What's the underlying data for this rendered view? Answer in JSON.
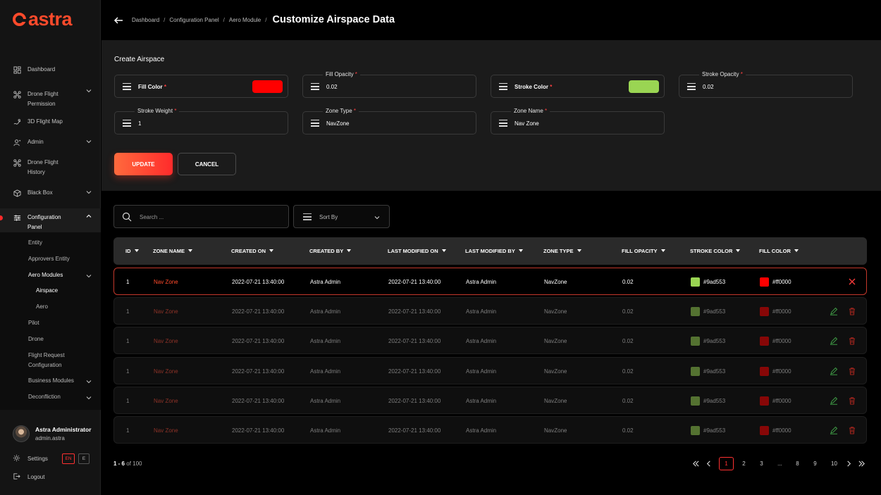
{
  "brand": {
    "name": "astra",
    "color": "#ff4a2b"
  },
  "sidebar": {
    "items": [
      {
        "label": "Dashboard",
        "icon": "dashboard-icon",
        "chevron": false
      },
      {
        "label": "Drone Flight",
        "label2": "Permission",
        "icon": "drone-icon",
        "chevron": true
      },
      {
        "label": "3D Flight Map",
        "icon": "map-icon",
        "chevron": false
      },
      {
        "label": "Admin",
        "icon": "admin-icon",
        "chevron": true
      },
      {
        "label": "Drone Flight",
        "label2": "History",
        "icon": "drone-icon",
        "chevron": false
      },
      {
        "label": "Black Box",
        "icon": "box-icon",
        "chevron": true
      },
      {
        "label": "Configuration",
        "label2": "Panel",
        "icon": "sliders-icon",
        "chevron": true
      }
    ],
    "subitems": [
      {
        "label": "Entity"
      },
      {
        "label": "Approvers Entity"
      },
      {
        "label": "Aero Modules"
      },
      {
        "label": "Airspace"
      },
      {
        "label": "Aero"
      },
      {
        "label": "Pilot"
      },
      {
        "label": "Drone"
      },
      {
        "label": "Flight Request",
        "label2": "Configuration"
      },
      {
        "label": "Business Modules"
      },
      {
        "label": "Deconfliction"
      }
    ],
    "user": {
      "name": "Astra Administrator",
      "email": "admin.astra"
    },
    "settings_label": "Settings",
    "lang_active": "EN",
    "lang_other": "E",
    "logout_label": "Logout"
  },
  "header": {
    "breadcrumbs": [
      "Dashboard",
      "Configuration Panel",
      "Aero Module"
    ],
    "separator": "/",
    "title": "Customize Airspace Data"
  },
  "form": {
    "title": "Create Airspace",
    "fill_color": {
      "label": "Fill Color",
      "value": "#ff0000"
    },
    "fill_opacity": {
      "label": "Fill Opacity",
      "value": "0.02"
    },
    "stroke_color": {
      "label": "Stroke Color",
      "value": "#9ad553"
    },
    "stroke_opacity": {
      "label": "Stroke Opacity",
      "value": "0.02"
    },
    "stroke_weight": {
      "label": "Stroke Weight",
      "value": "1"
    },
    "zone_type": {
      "label": "Zone Type",
      "value": "NavZone"
    },
    "zone_name": {
      "label": "Zone Name",
      "value": "Nav Zone"
    },
    "required_mark": "*",
    "update_label": "UPDATE",
    "cancel_label": "CANCEL"
  },
  "search": {
    "placeholder": "Search ..."
  },
  "sort": {
    "label": "Sort By"
  },
  "table": {
    "columns": [
      "ID",
      "ZONE NAME",
      "CREATED ON",
      "CREATED BY",
      "LAST MODIFIED ON",
      "LAST MODIFIED BY",
      "ZONE TYPE",
      "FILL OPACITY",
      "STROKE COLOR",
      "FILL COLOR"
    ],
    "rows": [
      {
        "id": "1",
        "zone_name": "Nav Zone",
        "created_on": "2022-07-21 13:40:00",
        "created_by": "Astra Admin",
        "modified_on": "2022-07-21 13:40:00",
        "modified_by": "Astra Admin",
        "zone_type": "NavZone",
        "fill_opacity": "0.02",
        "stroke_color": "#9ad553",
        "fill_color": "#ff0000",
        "selected": true
      },
      {
        "id": "1",
        "zone_name": "Nav Zone",
        "created_on": "2022-07-21 13:40:00",
        "created_by": "Astra Admin",
        "modified_on": "2022-07-21 13:40:00",
        "modified_by": "Astra Admin",
        "zone_type": "NavZone",
        "fill_opacity": "0.02",
        "stroke_color": "#9ad553",
        "fill_color": "#ff0000",
        "selected": false
      },
      {
        "id": "1",
        "zone_name": "Nav Zone",
        "created_on": "2022-07-21 13:40:00",
        "created_by": "Astra Admin",
        "modified_on": "2022-07-21 13:40:00",
        "modified_by": "Astra Admin",
        "zone_type": "NavZone",
        "fill_opacity": "0.02",
        "stroke_color": "#9ad553",
        "fill_color": "#ff0000",
        "selected": false
      },
      {
        "id": "1",
        "zone_name": "Nav Zone",
        "created_on": "2022-07-21 13:40:00",
        "created_by": "Astra Admin",
        "modified_on": "2022-07-21 13:40:00",
        "modified_by": "Astra Admin",
        "zone_type": "NavZone",
        "fill_opacity": "0.02",
        "stroke_color": "#9ad553",
        "fill_color": "#ff0000",
        "selected": false
      },
      {
        "id": "1",
        "zone_name": "Nav Zone",
        "created_on": "2022-07-21 13:40:00",
        "created_by": "Astra Admin",
        "modified_on": "2022-07-21 13:40:00",
        "modified_by": "Astra Admin",
        "zone_type": "NavZone",
        "fill_opacity": "0.02",
        "stroke_color": "#9ad553",
        "fill_color": "#ff0000",
        "selected": false
      },
      {
        "id": "1",
        "zone_name": "Nav Zone",
        "created_on": "2022-07-21 13:40:00",
        "created_by": "Astra Admin",
        "modified_on": "2022-07-21 13:40:00",
        "modified_by": "Astra Admin",
        "zone_type": "NavZone",
        "fill_opacity": "0.02",
        "stroke_color": "#9ad553",
        "fill_color": "#ff0000",
        "selected": false
      }
    ]
  },
  "pagination": {
    "range": "1 - 6",
    "of_label": "of",
    "total": "100",
    "pages": [
      "1",
      "2",
      "3",
      "...",
      "8",
      "9",
      "10"
    ],
    "current": "1"
  }
}
